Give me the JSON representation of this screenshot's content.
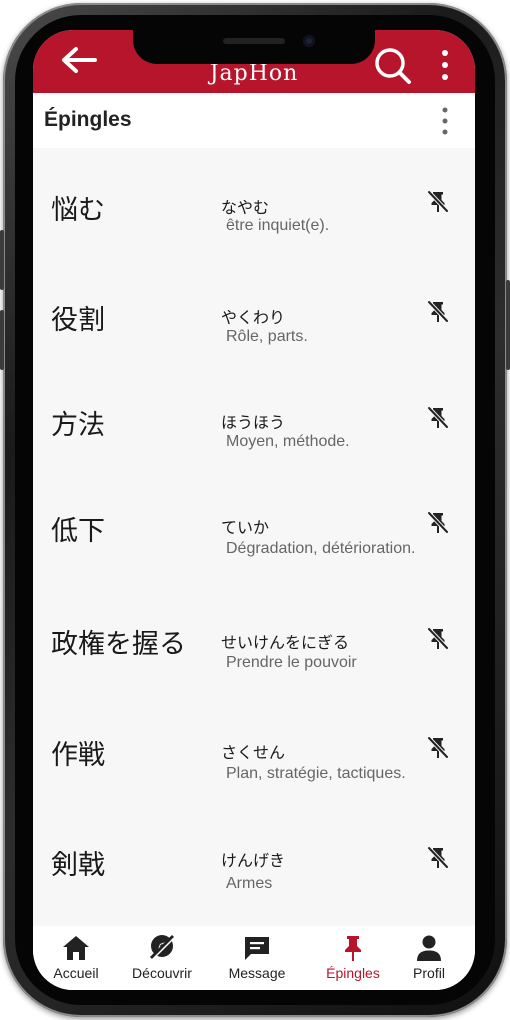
{
  "app": {
    "title": "JapHon"
  },
  "header": {
    "title": "Épingles"
  },
  "colors": {
    "brand": "#b6152b",
    "background": "#f7f7f7"
  },
  "pins": [
    {
      "word": "悩む",
      "reading": "なやむ",
      "meaning": "être inquiet(e)."
    },
    {
      "word": "役割",
      "reading": "やくわり",
      "meaning": "Rôle, parts."
    },
    {
      "word": "方法",
      "reading": "ほうほう",
      "meaning": "Moyen, méthode."
    },
    {
      "word": "低下",
      "reading": "ていか",
      "meaning": "Dégradation, détérioration."
    },
    {
      "word": "政権を握る",
      "reading": "せいけんをにぎる",
      "meaning": "Prendre le pouvoir"
    },
    {
      "word": "作戦",
      "reading": "さくせん",
      "meaning": "Plan, stratégie, tactiques."
    },
    {
      "word": "剣戟",
      "reading": "けんげき",
      "meaning": "Armes"
    }
  ],
  "bottom_nav": [
    {
      "label": "Accueil",
      "icon": "home-icon"
    },
    {
      "label": "Découvrir",
      "icon": "explore-icon"
    },
    {
      "label": "Message",
      "icon": "message-icon"
    },
    {
      "label": "Épingles",
      "icon": "pin-icon",
      "active": true
    },
    {
      "label": "Profil",
      "icon": "person-icon"
    }
  ]
}
